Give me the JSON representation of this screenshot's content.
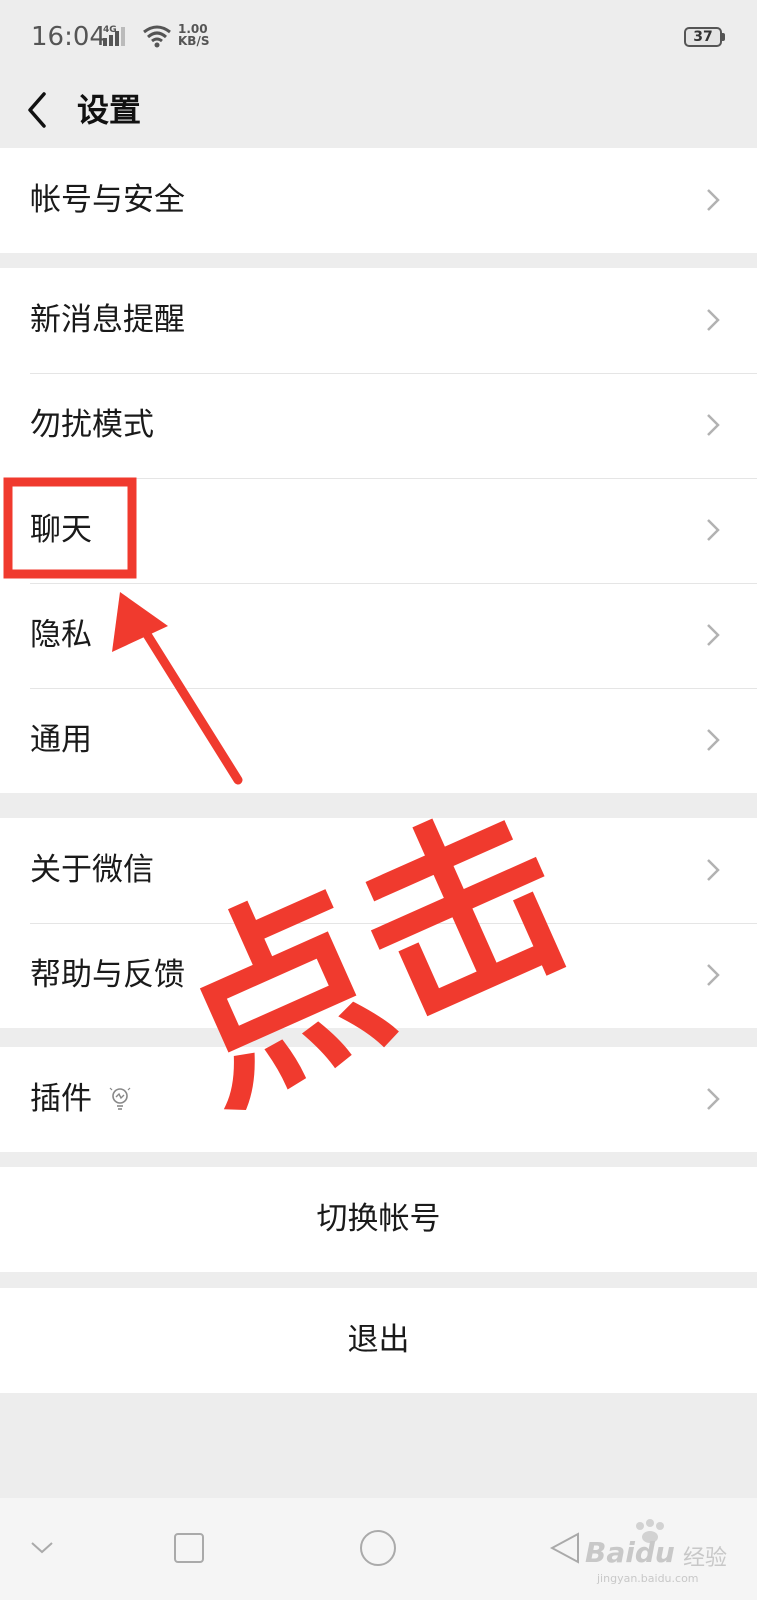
{
  "status_bar": {
    "time": "16:04",
    "network": "4G",
    "speed_value": "1.00",
    "speed_unit": "KB/S",
    "battery": "37"
  },
  "nav": {
    "title": "设置",
    "back_icon": "chevron-left-icon"
  },
  "groups": [
    {
      "items": [
        {
          "label": "帐号与安全"
        }
      ]
    },
    {
      "items": [
        {
          "label": "新消息提醒"
        },
        {
          "label": "勿扰模式"
        },
        {
          "label": "聊天"
        },
        {
          "label": "隐私"
        },
        {
          "label": "通用"
        }
      ]
    },
    {
      "items": [
        {
          "label": "关于微信"
        },
        {
          "label": "帮助与反馈"
        }
      ]
    },
    {
      "items": [
        {
          "label": "插件",
          "icon": "lightbulb-icon"
        }
      ]
    }
  ],
  "actions": {
    "switch_account": "切换帐号",
    "logout": "退出"
  },
  "annotation": {
    "text": "点击",
    "color": "#f03a2e"
  },
  "watermark": {
    "brand": "Baidu",
    "suffix": "经验",
    "url": "jingyan.baidu.com"
  },
  "colors": {
    "background": "#ededed",
    "card": "#ffffff",
    "annotation_red": "#f03a2e"
  }
}
